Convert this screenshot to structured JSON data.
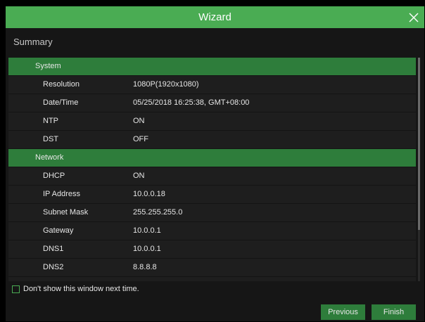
{
  "window": {
    "title": "Wizard"
  },
  "section_title": "Summary",
  "groups": [
    {
      "label": "System",
      "rows": [
        {
          "key": "Resolution",
          "value": "1080P(1920x1080)"
        },
        {
          "key": "Date/Time",
          "value": "05/25/2018 16:25:38, GMT+08:00"
        },
        {
          "key": "NTP",
          "value": "ON"
        },
        {
          "key": "DST",
          "value": "OFF"
        }
      ]
    },
    {
      "label": "Network",
      "rows": [
        {
          "key": "DHCP",
          "value": "ON"
        },
        {
          "key": "IP Address",
          "value": "10.0.0.18"
        },
        {
          "key": "Subnet Mask",
          "value": "255.255.255.0"
        },
        {
          "key": "Gateway",
          "value": "10.0.0.1"
        },
        {
          "key": "DNS1",
          "value": "10.0.0.1"
        },
        {
          "key": "DNS2",
          "value": "8.8.8.8"
        }
      ]
    }
  ],
  "footer": {
    "dont_show_label": "Don't show this window next time.",
    "dont_show_checked": false,
    "previous_label": "Previous",
    "finish_label": "Finish"
  },
  "colors": {
    "accent": "#4aac53",
    "group_row": "#2e7d3b",
    "background": "#161616"
  },
  "icons": {
    "close": "close-icon"
  }
}
